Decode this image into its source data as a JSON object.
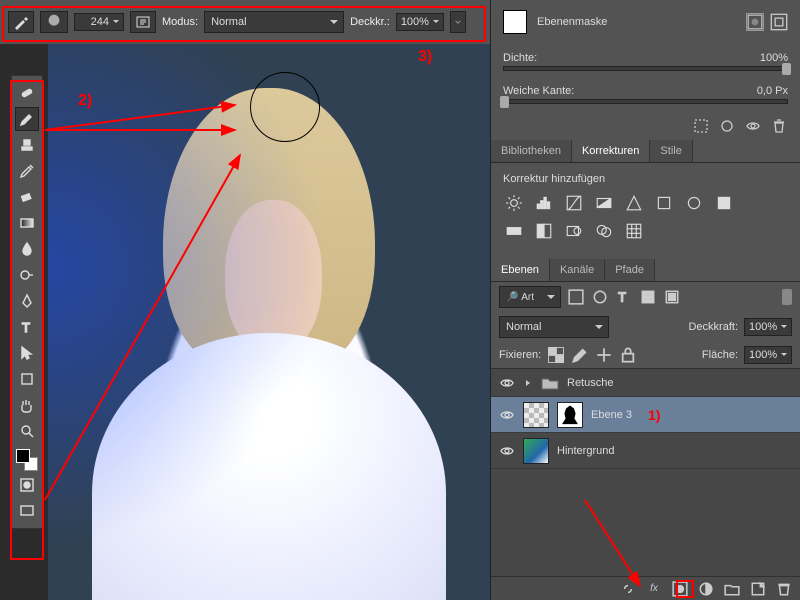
{
  "options_bar": {
    "brush_size": "244",
    "mode_label": "Modus:",
    "mode_value": "Normal",
    "opacity_label": "Deckkr.:",
    "opacity_value": "100%"
  },
  "annotations": {
    "one": "1)",
    "two": "2)",
    "three": "3)"
  },
  "masks_panel": {
    "title": "Ebenenmaske",
    "density_label": "Dichte:",
    "density_value": "100%",
    "feather_label": "Weiche Kante:",
    "feather_value": "0,0 Px"
  },
  "tabs_top": {
    "bibliotheken": "Bibliotheken",
    "korrekturen": "Korrekturen",
    "stile": "Stile"
  },
  "korrekturen": {
    "add_label": "Korrektur hinzufügen"
  },
  "tabs_layers": {
    "ebenen": "Ebenen",
    "kanaele": "Kanäle",
    "pfade": "Pfade"
  },
  "layers_panel": {
    "filter_kind": "Art",
    "blend_mode": "Normal",
    "opacity_label": "Deckkraft:",
    "opacity_value": "100%",
    "lock_label": "Fixieren:",
    "fill_label": "Fläche:",
    "fill_value": "100%",
    "group_name": "Retusche",
    "layer3": "Ebene 3",
    "background": "Hintergrund"
  },
  "search_placeholder": "Art",
  "fx_label": "fx"
}
